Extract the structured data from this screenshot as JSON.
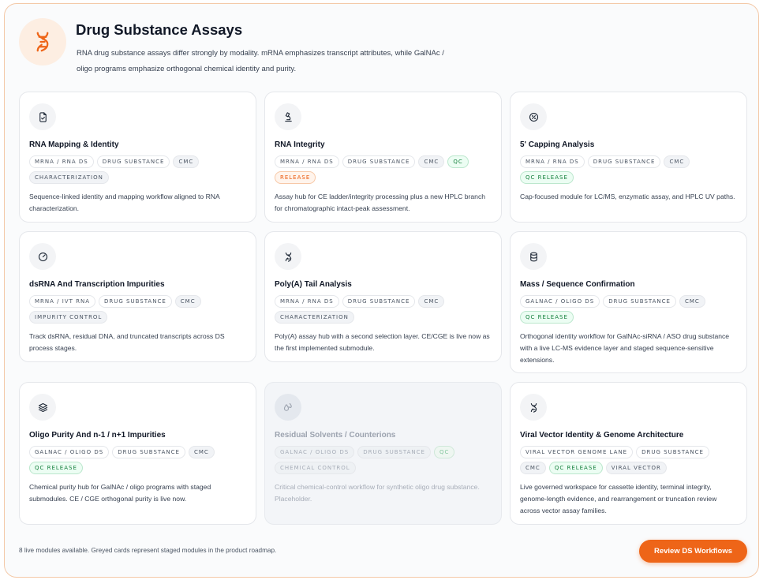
{
  "header": {
    "title": "Drug Substance Assays",
    "description": "RNA drug substance assays differ strongly by modality. mRNA emphasizes transcript attributes, while GalNAc / oligo programs emphasize orthogonal chemical identity and purity."
  },
  "cards": [
    {
      "icon": "document-icon",
      "title": "RNA Mapping & Identity",
      "tags": [
        {
          "label": "MRNA / RNA DS",
          "style": "plain"
        },
        {
          "label": "DRUG SUBSTANCE",
          "style": "plain"
        },
        {
          "label": "CMC",
          "style": "gray"
        },
        {
          "label": "CHARACTERIZATION",
          "style": "gray"
        }
      ],
      "description": "Sequence-linked identity and mapping workflow aligned to RNA characterization."
    },
    {
      "icon": "microscope-icon",
      "title": "RNA Integrity",
      "tags": [
        {
          "label": "MRNA / RNA DS",
          "style": "plain"
        },
        {
          "label": "DRUG SUBSTANCE",
          "style": "plain"
        },
        {
          "label": "CMC",
          "style": "gray"
        },
        {
          "label": "QC",
          "style": "green"
        },
        {
          "label": "RELEASE",
          "style": "orange"
        }
      ],
      "description": "Assay hub for CE ladder/integrity processing plus a new HPLC branch for chromatographic intact-peak assessment."
    },
    {
      "icon": "badge-percent-icon",
      "title": "5' Capping Analysis",
      "tags": [
        {
          "label": "MRNA / RNA DS",
          "style": "plain"
        },
        {
          "label": "DRUG SUBSTANCE",
          "style": "plain"
        },
        {
          "label": "CMC",
          "style": "gray"
        },
        {
          "label": "QC RELEASE",
          "style": "green"
        }
      ],
      "description": "Cap-focused module for LC/MS, enzymatic assay, and HPLC UV paths."
    },
    {
      "icon": "gauge-icon",
      "title": "dsRNA And Transcription Impurities",
      "tags": [
        {
          "label": "MRNA / IVT RNA",
          "style": "plain"
        },
        {
          "label": "DRUG SUBSTANCE",
          "style": "plain"
        },
        {
          "label": "CMC",
          "style": "gray"
        },
        {
          "label": "IMPURITY CONTROL",
          "style": "gray"
        }
      ],
      "description": "Track dsRNA, residual DNA, and truncated transcripts across DS process stages."
    },
    {
      "icon": "dna-icon",
      "title": "Poly(A) Tail Analysis",
      "tags": [
        {
          "label": "MRNA / RNA DS",
          "style": "plain"
        },
        {
          "label": "DRUG SUBSTANCE",
          "style": "plain"
        },
        {
          "label": "CMC",
          "style": "gray"
        },
        {
          "label": "CHARACTERIZATION",
          "style": "gray"
        }
      ],
      "description": "Poly(A) assay hub with a second selection layer. CE/CGE is live now as the first implemented submodule."
    },
    {
      "icon": "database-icon",
      "title": "Mass / Sequence Confirmation",
      "tags": [
        {
          "label": "GALNAC / OLIGO DS",
          "style": "plain"
        },
        {
          "label": "DRUG SUBSTANCE",
          "style": "plain"
        },
        {
          "label": "CMC",
          "style": "gray"
        },
        {
          "label": "QC RELEASE",
          "style": "green"
        }
      ],
      "description": "Orthogonal identity workflow for GalNAc-siRNA / ASO drug substance with a live LC-MS evidence layer and staged sequence-sensitive extensions."
    },
    {
      "icon": "layers-icon",
      "title": "Oligo Purity And n-1 / n+1 Impurities",
      "tags": [
        {
          "label": "GALNAC / OLIGO DS",
          "style": "plain"
        },
        {
          "label": "DRUG SUBSTANCE",
          "style": "plain"
        },
        {
          "label": "CMC",
          "style": "gray"
        },
        {
          "label": "QC RELEASE",
          "style": "green"
        }
      ],
      "description": "Chemical purity hub for GalNAc / oligo programs with staged submodules. CE / CGE orthogonal purity is live now."
    },
    {
      "icon": "droplets-icon",
      "title": "Residual Solvents / Counterions",
      "staged": true,
      "tags": [
        {
          "label": "GALNAC / OLIGO DS",
          "style": "plain"
        },
        {
          "label": "DRUG SUBSTANCE",
          "style": "gray"
        },
        {
          "label": "QC",
          "style": "green"
        },
        {
          "label": "CHEMICAL CONTROL",
          "style": "gray"
        }
      ],
      "description": "Critical chemical-control workflow for synthetic oligo drug substance. Placeholder."
    },
    {
      "icon": "dna-icon",
      "title": "Viral Vector Identity & Genome Architecture",
      "tags": [
        {
          "label": "VIRAL VECTOR GENOME LANE",
          "style": "plain"
        },
        {
          "label": "DRUG SUBSTANCE",
          "style": "plain"
        },
        {
          "label": "CMC",
          "style": "gray"
        },
        {
          "label": "QC RELEASE",
          "style": "green"
        },
        {
          "label": "VIRAL VECTOR",
          "style": "gray"
        }
      ],
      "description": "Live governed workspace for cassette identity, terminal integrity, genome-length evidence, and rearrangement or truncation review across vector assay families."
    }
  ],
  "footer": {
    "note": "8 live modules available. Greyed cards represent staged modules in the product roadmap.",
    "cta_label": "Review DS Workflows"
  },
  "colors": {
    "accent": "#ee6518",
    "accent_soft": "#fdeee2",
    "qc_green": "#15803d",
    "release_orange": "#ea580c"
  }
}
